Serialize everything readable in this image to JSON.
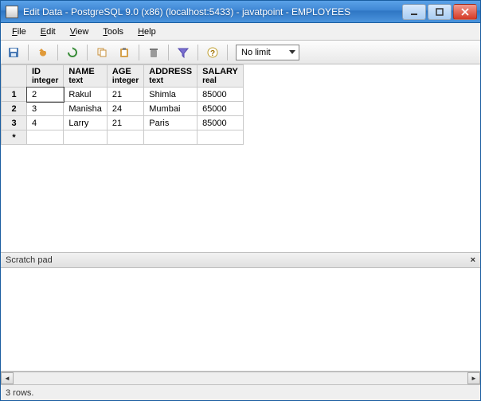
{
  "window": {
    "title": "Edit Data - PostgreSQL 9.0 (x86) (localhost:5433) - javatpoint - EMPLOYEES"
  },
  "menu": {
    "file": "File",
    "edit": "Edit",
    "view": "View",
    "tools": "Tools",
    "help": "Help"
  },
  "toolbar": {
    "limit_selected": "No limit"
  },
  "grid": {
    "row_labels": [
      "1",
      "2",
      "3"
    ],
    "columns": [
      {
        "name": "ID",
        "type": "integer"
      },
      {
        "name": "NAME",
        "type": "text"
      },
      {
        "name": "AGE",
        "type": "integer"
      },
      {
        "name": "ADDRESS",
        "type": "text"
      },
      {
        "name": "SALARY",
        "type": "real"
      }
    ],
    "rows": [
      {
        "ID": "2",
        "NAME": "Rakul",
        "AGE": "21",
        "ADDRESS": "Shimla",
        "SALARY": "85000"
      },
      {
        "ID": "3",
        "NAME": "Manisha",
        "AGE": "24",
        "ADDRESS": "Mumbai",
        "SALARY": "65000"
      },
      {
        "ID": "4",
        "NAME": "Larry",
        "AGE": "21",
        "ADDRESS": "Paris",
        "SALARY": "85000"
      }
    ],
    "editing": {
      "row": 0,
      "col": "ID"
    }
  },
  "scratch": {
    "title": "Scratch pad"
  },
  "status": {
    "text": "3 rows."
  }
}
